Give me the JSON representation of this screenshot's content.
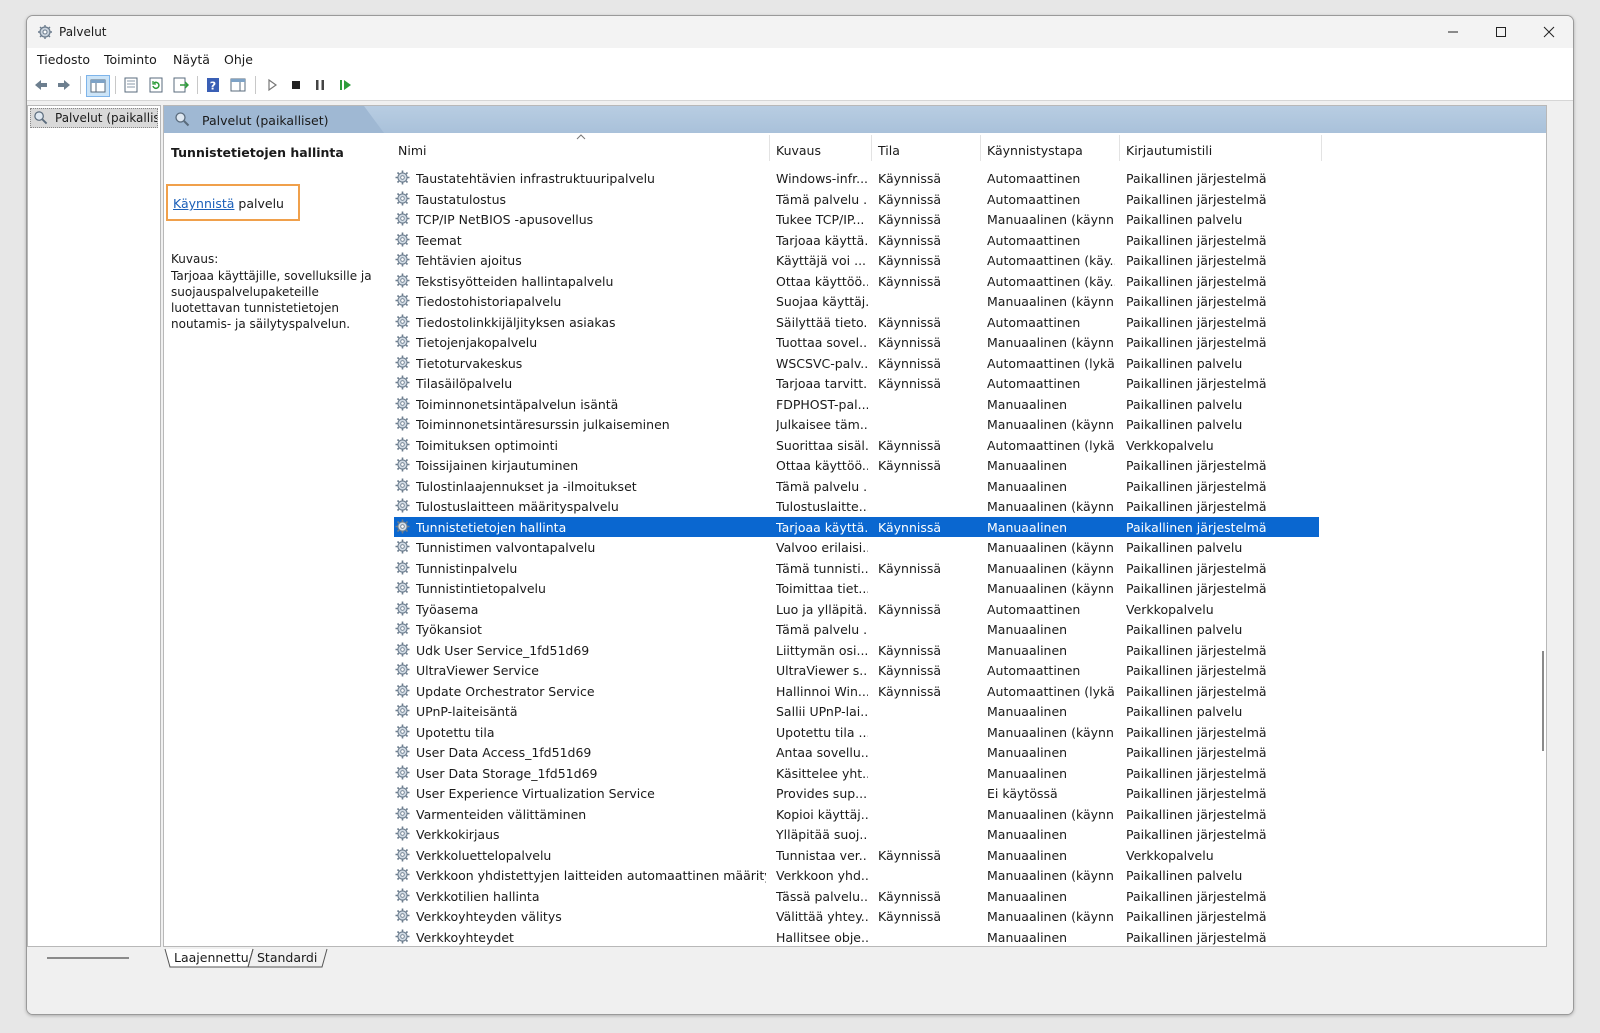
{
  "window": {
    "title": "Palvelut"
  },
  "menu": [
    "Tiedosto",
    "Toiminto",
    "Näytä",
    "Ohje"
  ],
  "tree": {
    "item": "Palvelut (paikalliset)"
  },
  "header": {
    "title": "Palvelut (paikalliset)"
  },
  "detail": {
    "title": "Tunnistetietojen hallinta",
    "start_link": "Käynnistä",
    "start_suffix": " palvelu",
    "desc_label": "Kuvaus:",
    "desc_text": "Tarjoaa käyttäjille, sovelluksille ja suojauspalvelupaketeille luotettavan tunnistetietojen noutamis- ja säilytyspalvelun."
  },
  "columns": [
    "Nimi",
    "Kuvaus",
    "Tila",
    "Käynnistystapa",
    "Kirjautumistili"
  ],
  "rows": [
    [
      "Taustatehtävien infrastruktuuripalvelu",
      "Windows-infr...",
      "Käynnissä",
      "Automaattinen",
      "Paikallinen järjestelmä"
    ],
    [
      "Taustatulostus",
      "Tämä palvelu ...",
      "Käynnissä",
      "Automaattinen",
      "Paikallinen järjestelmä"
    ],
    [
      "TCP/IP NetBIOS -apusovellus",
      "Tukee TCP/IP...",
      "Käynnissä",
      "Manuaalinen (käynn...",
      "Paikallinen palvelu"
    ],
    [
      "Teemat",
      "Tarjoaa käyttä...",
      "Käynnissä",
      "Automaattinen",
      "Paikallinen järjestelmä"
    ],
    [
      "Tehtävien ajoitus",
      "Käyttäjä voi ...",
      "Käynnissä",
      "Automaattinen (käy...",
      "Paikallinen järjestelmä"
    ],
    [
      "Tekstisyötteiden hallintapalvelu",
      "Ottaa käyttöö...",
      "Käynnissä",
      "Automaattinen (käy...",
      "Paikallinen järjestelmä"
    ],
    [
      "Tiedostohistoriapalvelu",
      "Suojaa käyttäj...",
      "",
      "Manuaalinen (käynn...",
      "Paikallinen järjestelmä"
    ],
    [
      "Tiedostolinkkijäljityksen asiakas",
      "Säilyttää tieto...",
      "Käynnissä",
      "Automaattinen",
      "Paikallinen järjestelmä"
    ],
    [
      "Tietojenjakopalvelu",
      "Tuottaa sovel...",
      "Käynnissä",
      "Manuaalinen (käynn...",
      "Paikallinen järjestelmä"
    ],
    [
      "Tietoturvakeskus",
      "WSCSVC-palv...",
      "Käynnissä",
      "Automaattinen (lykä...",
      "Paikallinen palvelu"
    ],
    [
      "Tilasäilöpalvelu",
      "Tarjoaa tarvitt...",
      "Käynnissä",
      "Automaattinen",
      "Paikallinen järjestelmä"
    ],
    [
      "Toiminnonetsintäpalvelun isäntä",
      "FDPHOST-pal...",
      "",
      "Manuaalinen",
      "Paikallinen palvelu"
    ],
    [
      "Toiminnonetsintäresurssin julkaiseminen",
      "Julkaisee täm...",
      "",
      "Manuaalinen (käynn...",
      "Paikallinen palvelu"
    ],
    [
      "Toimituksen optimointi",
      "Suorittaa sisäl...",
      "Käynnissä",
      "Automaattinen (lykä...",
      "Verkkopalvelu"
    ],
    [
      "Toissijainen kirjautuminen",
      "Ottaa käyttöö...",
      "Käynnissä",
      "Manuaalinen",
      "Paikallinen järjestelmä"
    ],
    [
      "Tulostinlaajennukset ja -ilmoitukset",
      "Tämä palvelu ...",
      "",
      "Manuaalinen",
      "Paikallinen järjestelmä"
    ],
    [
      "Tulostuslaitteen määrityspalvelu",
      "Tulostuslaitte...",
      "",
      "Manuaalinen (käynn...",
      "Paikallinen järjestelmä"
    ],
    [
      "Tunnistetietojen hallinta",
      "Tarjoaa käyttä...",
      "Käynnissä",
      "Manuaalinen",
      "Paikallinen järjestelmä"
    ],
    [
      "Tunnistimen valvontapalvelu",
      "Valvoo erilaisi...",
      "",
      "Manuaalinen (käynn...",
      "Paikallinen palvelu"
    ],
    [
      "Tunnistinpalvelu",
      "Tämä tunnisti...",
      "Käynnissä",
      "Manuaalinen (käynn...",
      "Paikallinen järjestelmä"
    ],
    [
      "Tunnistintietopalvelu",
      "Toimittaa tiet...",
      "",
      "Manuaalinen (käynn...",
      "Paikallinen järjestelmä"
    ],
    [
      "Työasema",
      "Luo ja ylläpitä...",
      "Käynnissä",
      "Automaattinen",
      "Verkkopalvelu"
    ],
    [
      "Työkansiot",
      "Tämä palvelu ...",
      "",
      "Manuaalinen",
      "Paikallinen palvelu"
    ],
    [
      "Udk User Service_1fd51d69",
      "Liittymän osi...",
      "Käynnissä",
      "Manuaalinen",
      "Paikallinen järjestelmä"
    ],
    [
      "UltraViewer Service",
      "UltraViewer s...",
      "Käynnissä",
      "Automaattinen",
      "Paikallinen järjestelmä"
    ],
    [
      "Update Orchestrator Service",
      "Hallinnoi Win...",
      "Käynnissä",
      "Automaattinen (lykä...",
      "Paikallinen järjestelmä"
    ],
    [
      "UPnP-laiteisäntä",
      "Sallii UPnP-lai...",
      "",
      "Manuaalinen",
      "Paikallinen palvelu"
    ],
    [
      "Upotettu tila",
      "Upotettu tila ...",
      "",
      "Manuaalinen (käynn...",
      "Paikallinen järjestelmä"
    ],
    [
      "User Data Access_1fd51d69",
      "Antaa sovellu...",
      "",
      "Manuaalinen",
      "Paikallinen järjestelmä"
    ],
    [
      "User Data Storage_1fd51d69",
      "Käsittelee yht...",
      "",
      "Manuaalinen",
      "Paikallinen järjestelmä"
    ],
    [
      "User Experience Virtualization Service",
      "Provides sup...",
      "",
      "Ei käytössä",
      "Paikallinen järjestelmä"
    ],
    [
      "Varmenteiden välittäminen",
      "Kopioi käyttäj...",
      "",
      "Manuaalinen (käynn...",
      "Paikallinen järjestelmä"
    ],
    [
      "Verkkokirjaus",
      "Ylläpitää suoj...",
      "",
      "Manuaalinen",
      "Paikallinen järjestelmä"
    ],
    [
      "Verkkoluettelopalvelu",
      "Tunnistaa ver...",
      "Käynnissä",
      "Manuaalinen",
      "Verkkopalvelu"
    ],
    [
      "Verkkoon yhdistettyjen laitteiden automaattinen määritys",
      "Verkkoon yhd...",
      "",
      "Manuaalinen (käynn...",
      "Paikallinen palvelu"
    ],
    [
      "Verkkotilien hallinta",
      "Tässä palvelu...",
      "Käynnissä",
      "Manuaalinen",
      "Paikallinen järjestelmä"
    ],
    [
      "Verkkoyhteyden välitys",
      "Välittää yhtey...",
      "Käynnissä",
      "Manuaalinen (käynn...",
      "Paikallinen järjestelmä"
    ],
    [
      "Verkkoyhteydet",
      "Hallitsee obje...",
      "",
      "Manuaalinen",
      "Paikallinen järjestelmä"
    ]
  ],
  "selected_row": 17,
  "tabs": [
    "Laajennettu",
    "Standardi"
  ],
  "colors": {
    "selection": "#0a67d0",
    "header_band": "#a9c1da",
    "link": "#1b5fb8",
    "highlight_box": "#f0a04b"
  }
}
